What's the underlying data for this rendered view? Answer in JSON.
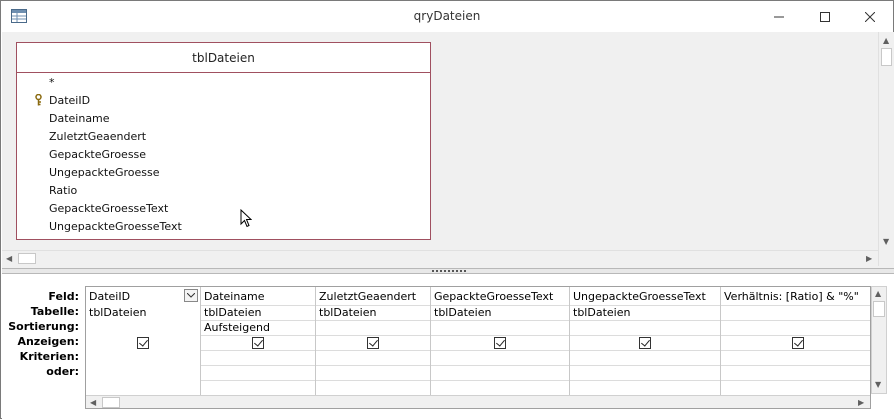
{
  "window": {
    "title": "qryDateien"
  },
  "table": {
    "name": "tblDateien",
    "fields": [
      "*",
      "DateiID",
      "Dateiname",
      "ZuletztGeaendert",
      "GepackteGroesse",
      "UngepackteGroesse",
      "Ratio",
      "GepackteGroesseText",
      "UngepackteGroesseText"
    ],
    "key_field": "DateiID"
  },
  "grid": {
    "row_labels": [
      "Feld:",
      "Tabelle:",
      "Sortierung:",
      "Anzeigen:",
      "Kriterien:",
      "oder:"
    ],
    "columns": [
      {
        "feld": "DateiID",
        "tabelle": "tblDateien",
        "sortierung": "",
        "anzeigen": true
      },
      {
        "feld": "Dateiname",
        "tabelle": "tblDateien",
        "sortierung": "Aufsteigend",
        "anzeigen": true
      },
      {
        "feld": "ZuletztGeaendert",
        "tabelle": "tblDateien",
        "sortierung": "",
        "anzeigen": true
      },
      {
        "feld": "GepackteGroesseText",
        "tabelle": "tblDateien",
        "sortierung": "",
        "anzeigen": true
      },
      {
        "feld": "UngepackteGroesseText",
        "tabelle": "tblDateien",
        "sortierung": "",
        "anzeigen": true
      },
      {
        "feld": "Verhältnis: [Ratio] & \"%\"",
        "tabelle": "",
        "sortierung": "",
        "anzeigen": true
      }
    ]
  },
  "icons": {
    "app": "access-query-icon",
    "minimize": "minimize-icon",
    "maximize": "maximize-icon",
    "close": "close-icon",
    "key": "primary-key-icon",
    "cursor": "mouse-pointer-icon"
  }
}
